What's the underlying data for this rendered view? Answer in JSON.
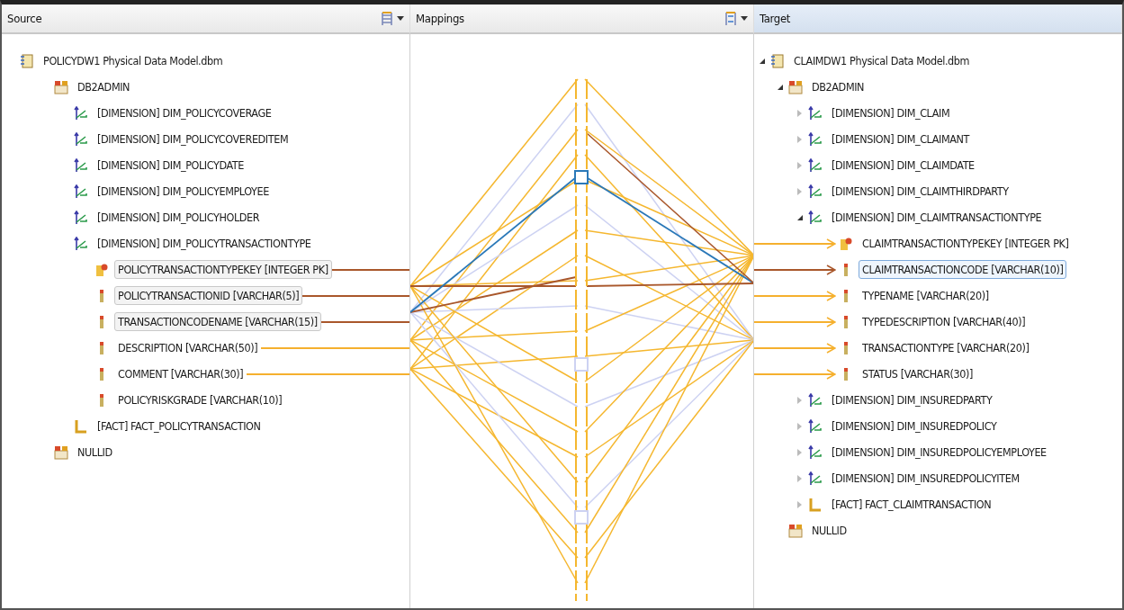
{
  "source": {
    "title": "Source",
    "tree": [
      {
        "kind": "model",
        "label": "POLICYDW1 Physical Data Model.dbm",
        "children": [
          {
            "kind": "schema",
            "label": "DB2ADMIN",
            "children": [
              {
                "kind": "dimension",
                "label": "[DIMENSION] DIM_POLICYCOVERAGE"
              },
              {
                "kind": "dimension",
                "label": "[DIMENSION] DIM_POLICYCOVEREDITEM"
              },
              {
                "kind": "dimension",
                "label": "[DIMENSION] DIM_POLICYDATE"
              },
              {
                "kind": "dimension",
                "label": "[DIMENSION] DIM_POLICYEMPLOYEE"
              },
              {
                "kind": "dimension",
                "label": "[DIMENSION] DIM_POLICYHOLDER"
              },
              {
                "kind": "dimension",
                "label": "[DIMENSION] DIM_POLICYTRANSACTIONTYPE",
                "children": [
                  {
                    "kind": "key",
                    "label": "POLICYTRANSACTIONTYPEKEY [INTEGER PK]",
                    "selected": true,
                    "color": "#a9572b"
                  },
                  {
                    "kind": "column",
                    "label": "POLICYTRANSACTIONID [VARCHAR(5)]",
                    "selected": true,
                    "color": "#a9572b"
                  },
                  {
                    "kind": "column",
                    "label": "TRANSACTIONCODENAME [VARCHAR(15)]",
                    "selected": true,
                    "color": "#a9572b"
                  },
                  {
                    "kind": "column",
                    "label": "DESCRIPTION [VARCHAR(50)]",
                    "selected": false,
                    "color": "#f5b02e"
                  },
                  {
                    "kind": "column",
                    "label": "COMMENT [VARCHAR(30)]",
                    "selected": false,
                    "color": "#f5b02e"
                  },
                  {
                    "kind": "column",
                    "label": "POLICYRISKGRADE [VARCHAR(10)]",
                    "selected": false
                  }
                ]
              },
              {
                "kind": "fact",
                "label": "[FACT] FACT_POLICYTRANSACTION"
              }
            ]
          },
          {
            "kind": "schema",
            "label": "NULLID"
          }
        ]
      }
    ]
  },
  "mappings": {
    "title": "Mappings"
  },
  "target": {
    "title": "Target",
    "tree": [
      {
        "kind": "model",
        "label": "CLAIMDW1 Physical Data Model.dbm",
        "expanded": true,
        "children": [
          {
            "kind": "schema",
            "label": "DB2ADMIN",
            "expanded": true,
            "children": [
              {
                "kind": "dimension",
                "label": "[DIMENSION] DIM_CLAIM",
                "expanded": false
              },
              {
                "kind": "dimension",
                "label": "[DIMENSION] DIM_CLAIMANT",
                "expanded": false
              },
              {
                "kind": "dimension",
                "label": "[DIMENSION] DIM_CLAIMDATE",
                "expanded": false
              },
              {
                "kind": "dimension",
                "label": "[DIMENSION] DIM_CLAIMTHIRDPARTY",
                "expanded": false
              },
              {
                "kind": "dimension",
                "label": "[DIMENSION] DIM_CLAIMTRANSACTIONTYPE",
                "expanded": true,
                "children": [
                  {
                    "kind": "key",
                    "label": "CLAIMTRANSACTIONTYPEKEY [INTEGER PK]",
                    "selected": false,
                    "color": "#f5b02e"
                  },
                  {
                    "kind": "column",
                    "label": "CLAIMTRANSACTIONCODE [VARCHAR(10)]",
                    "selected": true,
                    "color": "#a9572b"
                  },
                  {
                    "kind": "column",
                    "label": "TYPENAME [VARCHAR(20)]",
                    "selected": false,
                    "color": "#f5b02e"
                  },
                  {
                    "kind": "column",
                    "label": "TYPEDESCRIPTION [VARCHAR(40)]",
                    "selected": false,
                    "color": "#f5b02e"
                  },
                  {
                    "kind": "column",
                    "label": "TRANSACTIONTYPE [VARCHAR(20)]",
                    "selected": false,
                    "color": "#f5b02e"
                  },
                  {
                    "kind": "column",
                    "label": "STATUS [VARCHAR(30)]",
                    "selected": false,
                    "color": "#f5b02e"
                  }
                ]
              },
              {
                "kind": "dimension",
                "label": "[DIMENSION] DIM_INSUREDPARTY",
                "expanded": false
              },
              {
                "kind": "dimension",
                "label": "[DIMENSION] DIM_INSUREDPOLICY",
                "expanded": false
              },
              {
                "kind": "dimension",
                "label": "[DIMENSION] DIM_INSUREDPOLICYEMPLOYEE",
                "expanded": false
              },
              {
                "kind": "dimension",
                "label": "[DIMENSION] DIM_INSUREDPOLICYITEM",
                "expanded": false
              },
              {
                "kind": "fact",
                "label": "[FACT] FACT_CLAIMTRANSACTION",
                "expanded": false
              }
            ]
          },
          {
            "kind": "schema",
            "label": "NULLID"
          }
        ]
      }
    ]
  }
}
